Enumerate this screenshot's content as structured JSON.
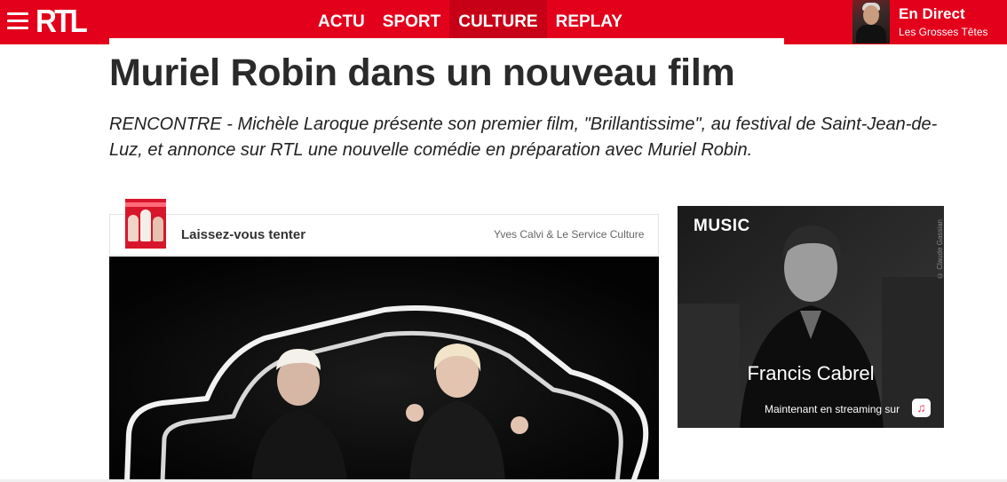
{
  "header": {
    "logo_text": "RTL",
    "nav": [
      "ACTU",
      "SPORT",
      "CULTURE",
      "REPLAY"
    ],
    "active_nav": "CULTURE",
    "live": {
      "title": "En Direct",
      "subtitle": "Les Grosses Têtes"
    }
  },
  "article": {
    "title": "Muriel Robin dans un nouveau film",
    "lede": "RENCONTRE - Michèle Laroque présente son premier film, \"Brillantissime\", au festival de Saint-Jean-de-Luz, et annonce sur RTL une nouvelle comédie en préparation avec Muriel Robin."
  },
  "player": {
    "show_title": "Laissez-vous tenter",
    "host": "Yves Calvi & Le Service Culture"
  },
  "ad": {
    "brand": "MUSIC",
    "credit": "© Claude Gassian",
    "artist": "Francis Cabrel",
    "cta": "Maintenant en streaming sur"
  },
  "colors": {
    "brand_red": "#e3001b",
    "active_tab": "#c80017"
  },
  "icons": [
    "menu-icon",
    "apple-icon",
    "apple-music-icon"
  ]
}
